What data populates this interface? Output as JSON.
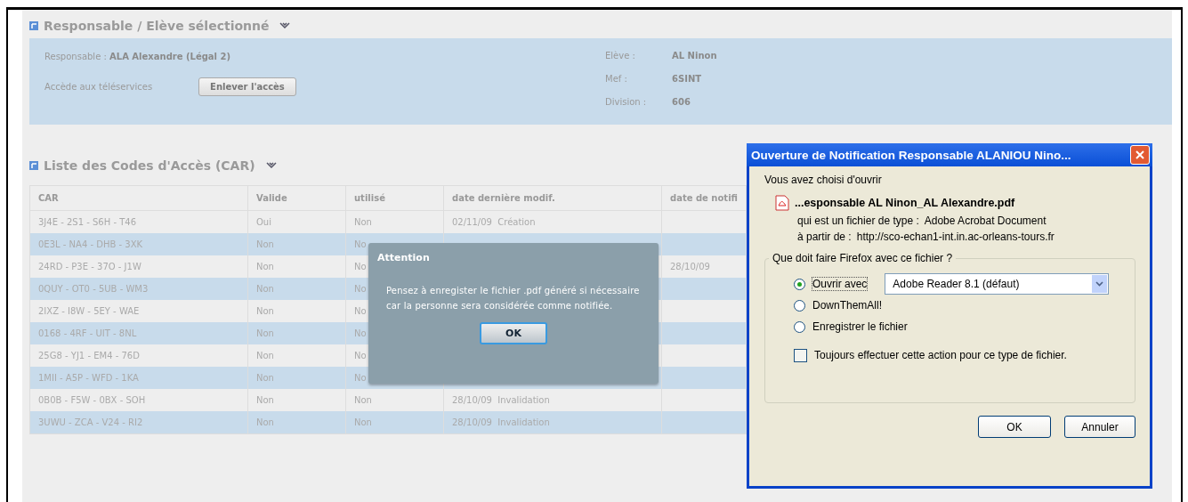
{
  "selected_panel": {
    "title": "Responsable / Elève sélectionné",
    "responsable_label": "Responsable :",
    "responsable_value": "ALA Alexandre (Légal 2)",
    "teleservices_label": "Accède aux téléservices",
    "remove_access_button": "Enlever l'accès",
    "fields": [
      {
        "label": "Elève :",
        "value": "AL Ninon"
      },
      {
        "label": "Mef :",
        "value": "6SINT"
      },
      {
        "label": "Division :",
        "value": "606"
      }
    ]
  },
  "car_list": {
    "title": "Liste des Codes d'Accès (CAR)",
    "columns": [
      "CAR",
      "Valide",
      "utilisé",
      "date dernière modif.",
      "date de notifi"
    ],
    "rows": [
      [
        "3J4E - 2S1 - S6H - T46",
        "Oui",
        "Non",
        "02/11/09  Création",
        ""
      ],
      [
        "0E3L - NA4 - DHB - 3XK",
        "Non",
        "No",
        "",
        ""
      ],
      [
        "24RD - P3E - 37O - J1W",
        "Non",
        "No",
        "",
        "28/10/09"
      ],
      [
        "0QUY - OT0 - 5UB - WM3",
        "Non",
        "No",
        "",
        ""
      ],
      [
        "2IXZ - I8W - 5EY - WAE",
        "Non",
        "No",
        "",
        ""
      ],
      [
        "0168 - 4RF - UIT - 8NL",
        "Non",
        "No",
        "",
        ""
      ],
      [
        "25G8 - YJ1 - EM4 - 76D",
        "Non",
        "No",
        "",
        ""
      ],
      [
        "1MII - A5P - WFD - 1KA",
        "Non",
        "No",
        "",
        ""
      ],
      [
        "0B0B - F5W - 0BX - SOH",
        "Non",
        "Non",
        "28/10/09  Invalidation",
        ""
      ],
      [
        "3UWU - ZCA - V24 - RI2",
        "Non",
        "Non",
        "28/10/09  Invalidation",
        ""
      ]
    ]
  },
  "alert": {
    "title": "Attention",
    "message": "Pensez à enregister le fichier .pdf généré si nécessaire car la personne sera considérée comme notifiée.",
    "button": "OK"
  },
  "download_dialog": {
    "title": "Ouverture de Notification Responsable ALANIOU Nino...",
    "intro": "Vous avez choisi d'ouvrir",
    "filename": "...esponsable AL Ninon_AL Alexandre.pdf",
    "type_label": "qui est un fichier de type :",
    "type_value": "Adobe Acrobat Document",
    "source_label": "à partir de :",
    "source_value": "http://sco-echan1-int.in.ac-orleans-tours.fr",
    "group_title": "Que doit faire Firefox avec ce fichier ?",
    "options": [
      {
        "label": "Ouvrir avec",
        "selected": true,
        "app": "Adobe Reader 8.1 (défaut)"
      },
      {
        "label": "DownThemAll!",
        "selected": false
      },
      {
        "label": "Enregistrer le fichier",
        "selected": false
      }
    ],
    "always": {
      "label": "Toujours effectuer cette action pour ce type de fichier.",
      "checked": false
    },
    "buttons": [
      "OK",
      "Annuler"
    ]
  }
}
